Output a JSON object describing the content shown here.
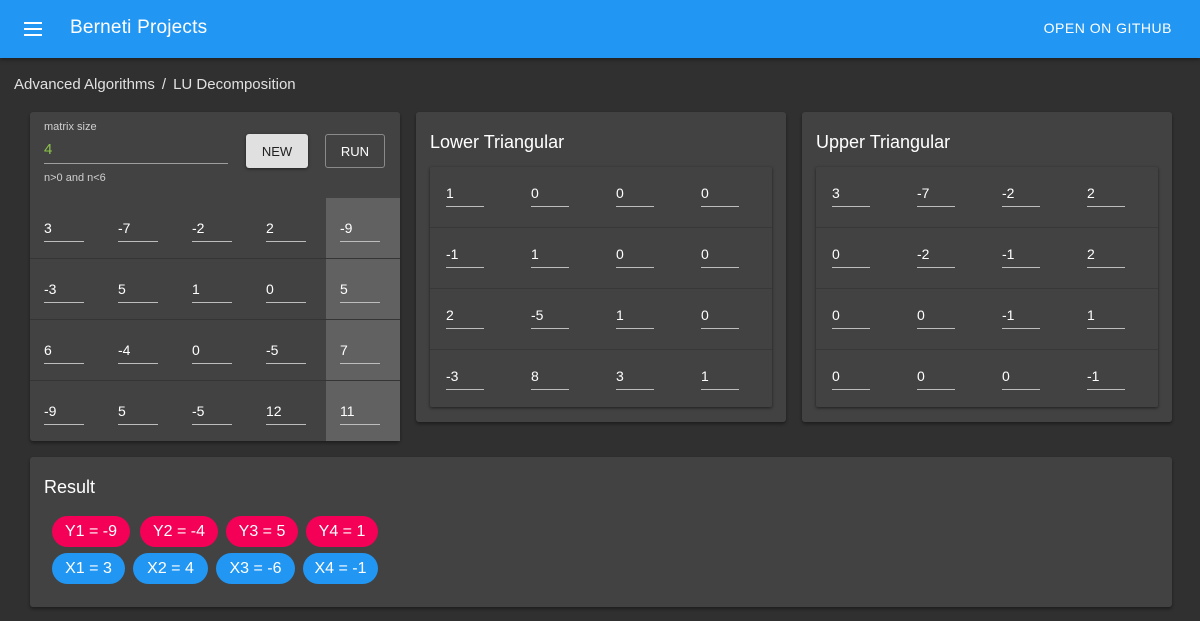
{
  "appbar": {
    "title": "Berneti Projects",
    "github_label": "OPEN ON GITHUB"
  },
  "breadcrumb": [
    "Advanced Algorithms",
    "/",
    "LU Decomposition"
  ],
  "input": {
    "size_label": "matrix size",
    "size_value": "4",
    "size_hint": "n>0 and n<6",
    "new_label": "NEW",
    "run_label": "RUN",
    "matrix": [
      [
        "3",
        "-7",
        "-2",
        "2"
      ],
      [
        "-3",
        "5",
        "1",
        "0"
      ],
      [
        "6",
        "-4",
        "0",
        "-5"
      ],
      [
        "-9",
        "5",
        "-5",
        "12"
      ]
    ],
    "rhs": [
      "-9",
      "5",
      "7",
      "11"
    ]
  },
  "lower": {
    "title": "Lower Triangular",
    "matrix": [
      [
        "1",
        "0",
        "0",
        "0"
      ],
      [
        "-1",
        "1",
        "0",
        "0"
      ],
      [
        "2",
        "-5",
        "1",
        "0"
      ],
      [
        "-3",
        "8",
        "3",
        "1"
      ]
    ]
  },
  "upper": {
    "title": "Upper Triangular",
    "matrix": [
      [
        "3",
        "-7",
        "-2",
        "2"
      ],
      [
        "0",
        "-2",
        "-1",
        "2"
      ],
      [
        "0",
        "0",
        "-1",
        "1"
      ],
      [
        "0",
        "0",
        "0",
        "-1"
      ]
    ]
  },
  "result": {
    "title": "Result",
    "y": [
      "Y1 = -9",
      "Y2 = -4",
      "Y3 = 5",
      "Y4 = 1"
    ],
    "x": [
      "X1 = 3",
      "X2 = 4",
      "X3 = -6",
      "X4 = -1"
    ]
  },
  "colors": {
    "appbar": "#2196f3",
    "y_chip": "#f50057",
    "x_chip": "#2196f3",
    "size_value": "#8bc34a"
  }
}
